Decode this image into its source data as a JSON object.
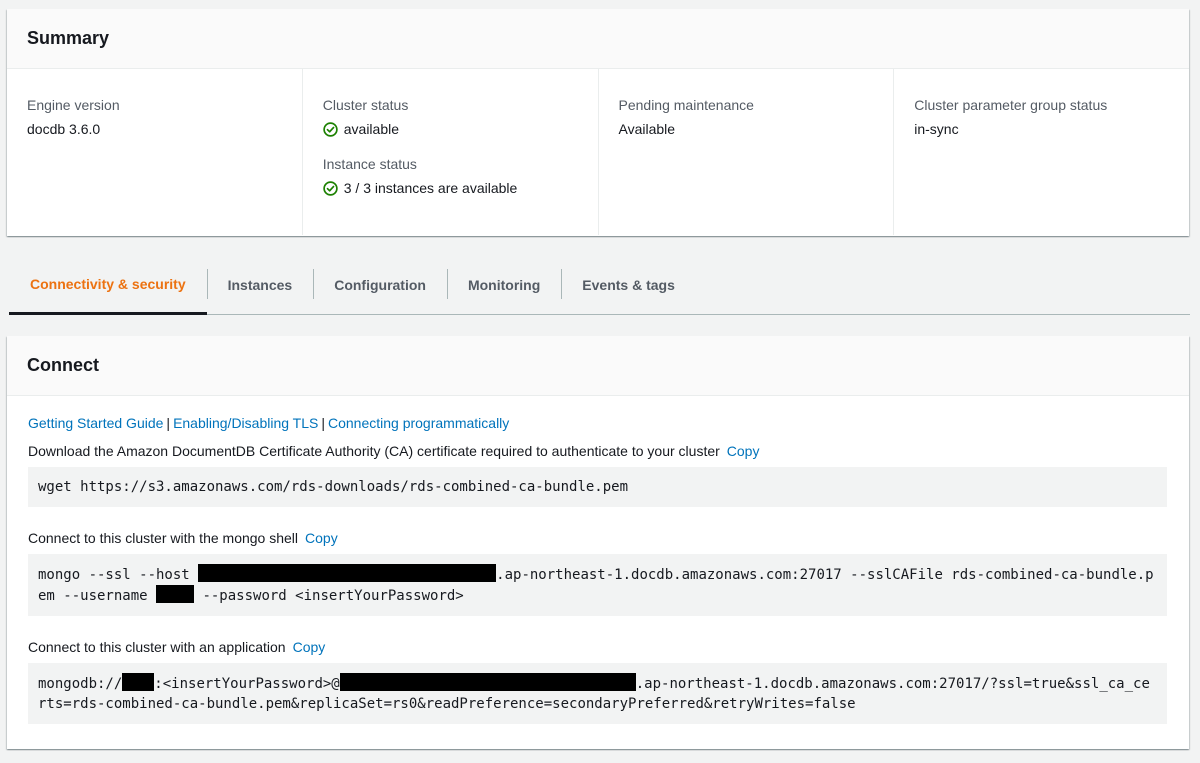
{
  "summary": {
    "title": "Summary",
    "engine_version": {
      "label": "Engine version",
      "value": "docdb 3.6.0"
    },
    "cluster_status": {
      "label": "Cluster status",
      "value": "available"
    },
    "instance_status": {
      "label": "Instance status",
      "value": "3 / 3 instances are available"
    },
    "pending_maintenance": {
      "label": "Pending maintenance",
      "value": "Available"
    },
    "param_group_status": {
      "label": "Cluster parameter group status",
      "value": "in-sync"
    }
  },
  "tabs": [
    {
      "label": "Connectivity & security",
      "active": true
    },
    {
      "label": "Instances",
      "active": false
    },
    {
      "label": "Configuration",
      "active": false
    },
    {
      "label": "Monitoring",
      "active": false
    },
    {
      "label": "Events & tags",
      "active": false
    }
  ],
  "connect": {
    "title": "Connect",
    "links": [
      "Getting Started Guide",
      "Enabling/Disabling TLS",
      "Connecting programmatically"
    ],
    "link_separator": "|",
    "copy_label": "Copy",
    "ca": {
      "description": "Download the Amazon DocumentDB Certificate Authority (CA) certificate required to authenticate to your cluster",
      "command": "wget https://s3.amazonaws.com/rds-downloads/rds-combined-ca-bundle.pem"
    },
    "shell": {
      "description": "Connect to this cluster with the mongo shell",
      "part1": "mongo --ssl --host ",
      "part2": ".ap-northeast-1.docdb.amazonaws.com:27017 --sslCAFile rds-combined-ca-bundle.pem --username ",
      "part3": " --password <insertYourPassword>"
    },
    "app": {
      "description": "Connect to this cluster with an application",
      "part1": "mongodb://",
      "part2": ":<insertYourPassword>@",
      "part3": ".ap-northeast-1.docdb.amazonaws.com:27017/?ssl=true&ssl_ca_certs=rds-combined-ca-bundle.pem&replicaSet=rs0&readPreference=secondaryPreferred&retryWrites=false"
    }
  },
  "colors": {
    "link": "#0073bb",
    "active_tab": "#ec7211",
    "success": "#1d8102"
  },
  "icons": {
    "status_ok": "check-circle-icon"
  }
}
